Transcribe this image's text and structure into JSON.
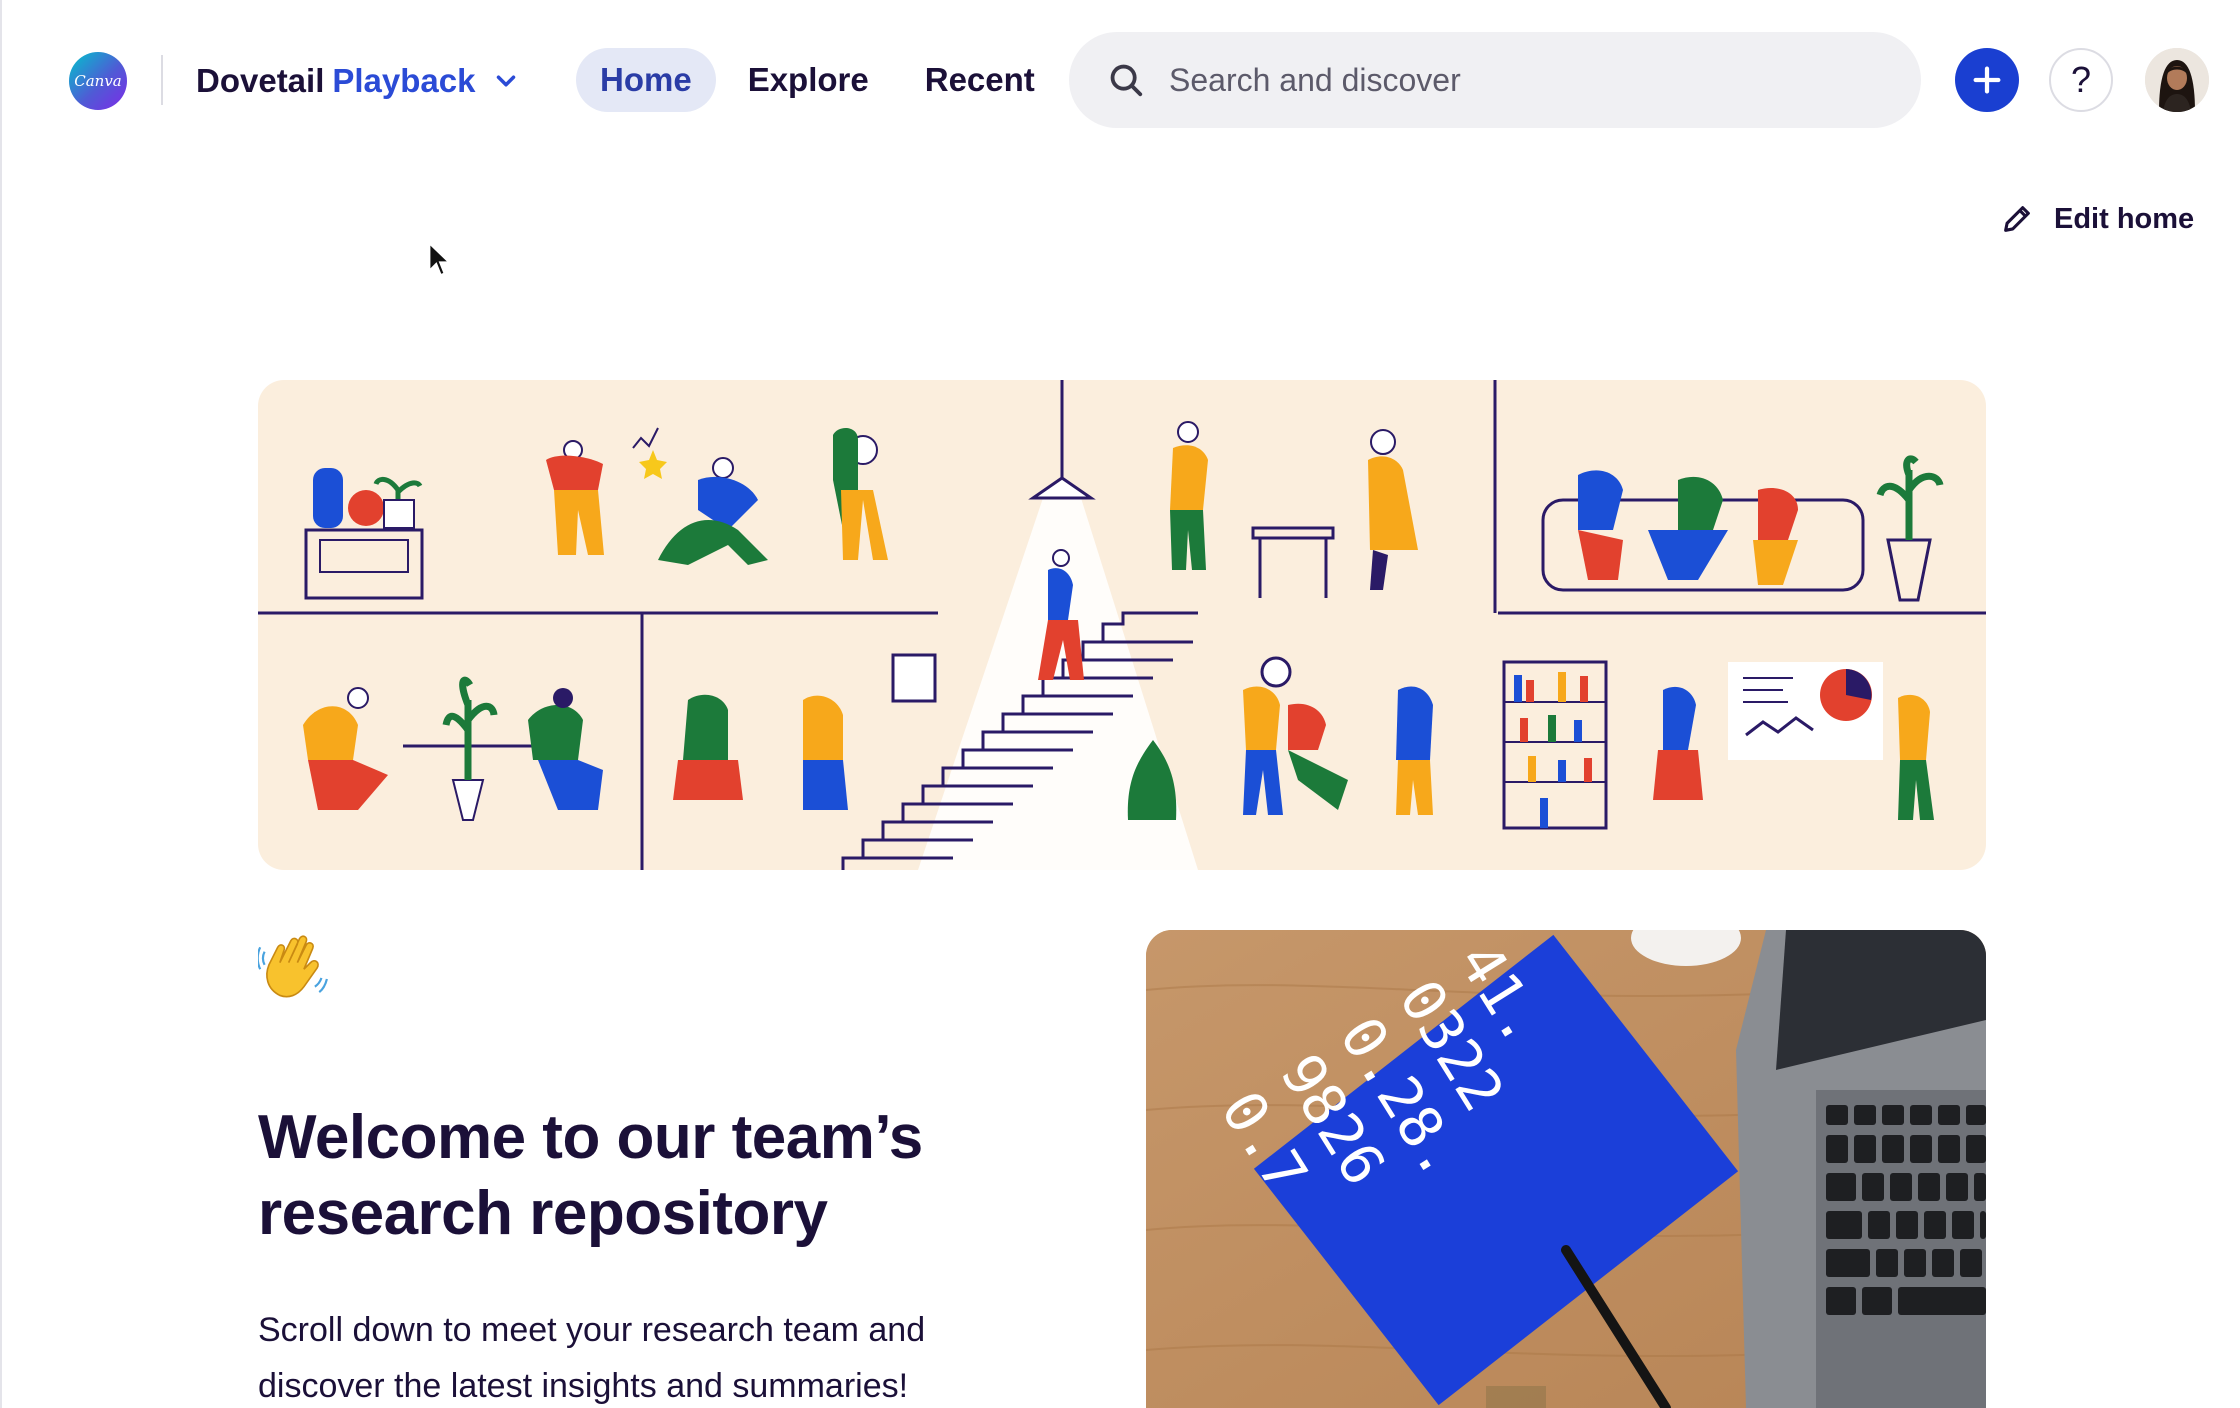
{
  "header": {
    "logo_text": "Canva",
    "workspace": {
      "name_part1": "Dovetail",
      "name_part2": "Playback"
    },
    "nav": [
      {
        "label": "Home",
        "active": true
      },
      {
        "label": "Explore",
        "active": false
      },
      {
        "label": "Recent",
        "active": false
      }
    ],
    "search": {
      "placeholder": "Search and discover",
      "icon": "search-icon"
    },
    "add_button_icon": "plus-icon",
    "help_label": "?",
    "colors": {
      "accent": "#1a3fd1",
      "nav_active_bg": "#e4e8f6",
      "workspace_accent": "#2b4bd6"
    }
  },
  "toolbar": {
    "edit_home_label": "Edit home",
    "edit_icon": "pencil-icon"
  },
  "banner": {
    "illustration": "team-office-illustration",
    "background": "#fbeedd"
  },
  "welcome": {
    "emoji": "👋",
    "title_line1": "Welcome to our team’s",
    "title_line2": "research repository",
    "body_line1": "Scroll down to meet your research team and",
    "body_line2": "discover the latest insights and summaries!"
  },
  "photo": {
    "notebook_lines": [
      "41.",
      "0322",
      "0.28.",
      "9826",
      "0.7"
    ]
  }
}
